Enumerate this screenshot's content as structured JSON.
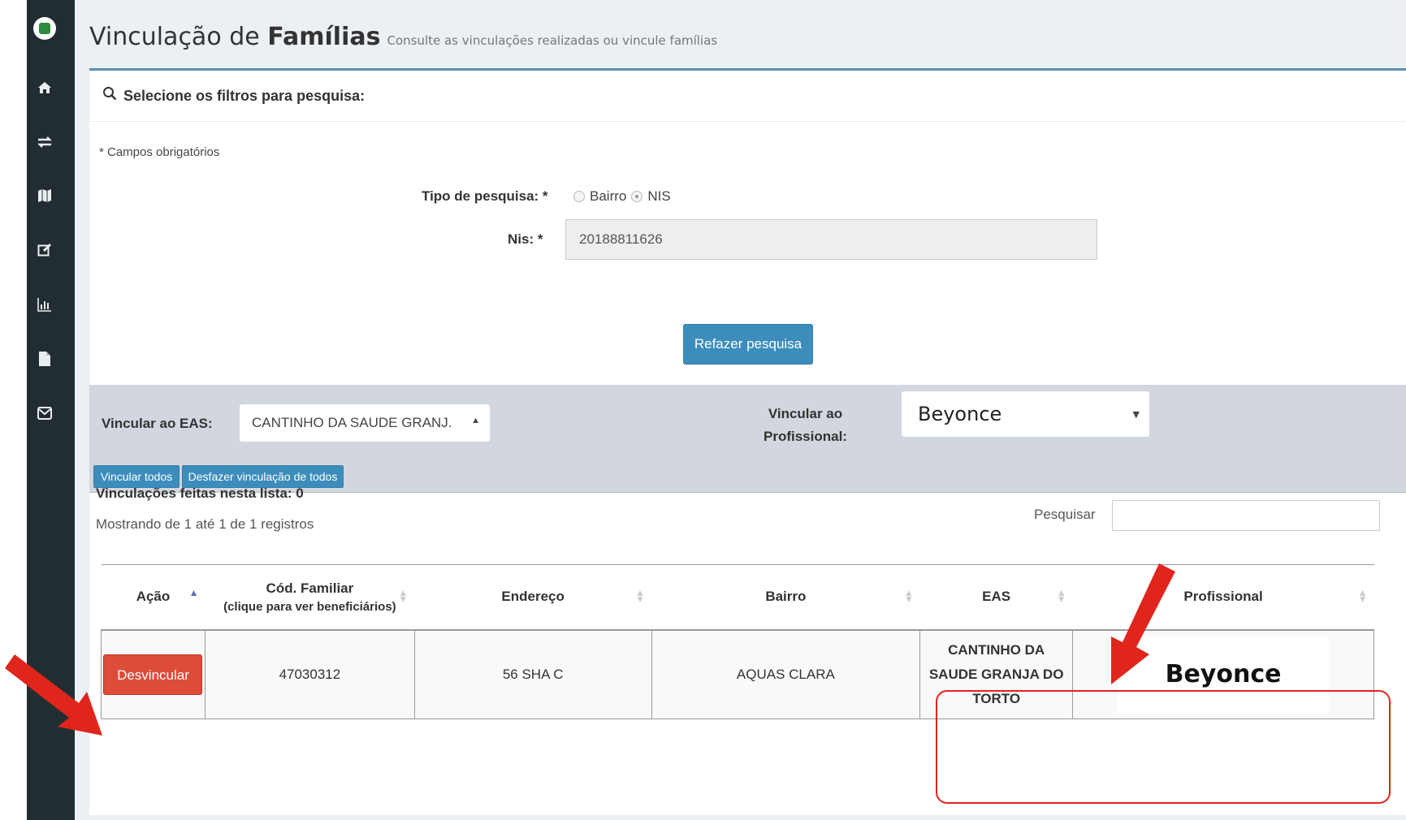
{
  "sidebar": {
    "icons": [
      "logo-icon",
      "home-icon",
      "transfer-icon",
      "map-icon",
      "edit-icon",
      "bar-chart-icon",
      "file-icon",
      "mail-icon"
    ]
  },
  "header": {
    "title_prefix": "Vinculação de",
    "title_bold": "Famílias",
    "subtitle": "Consulte as vinculações realizadas ou vincule famílias"
  },
  "filters": {
    "box_title": "Selecione os filtros para pesquisa:",
    "required_note": "* Campos obrigatórios",
    "search_type_label": "Tipo de pesquisa: *",
    "option_bairro": "Bairro",
    "option_nis": "NIS",
    "selected_option": "NIS",
    "nis_label": "Nis: *",
    "nis_value": "20188811626",
    "redo_button": "Refazer pesquisa"
  },
  "link": {
    "eas_label": "Vincular ao EAS:",
    "eas_value": "CANTINHO DA SAUDE GRANJ.",
    "prof_label_line1": "Vincular ao",
    "prof_label_line2": "Profissional:",
    "prof_value": "Beyonce",
    "link_all_button": "Vincular todos",
    "unlink_all_button": "Desfazer vinculação de todos"
  },
  "table": {
    "count_label": "Vinculações feitas nesta lista: 0",
    "showing_text": "Mostrando de 1 até 1 de 1 registros",
    "search_label": "Pesquisar",
    "columns": {
      "acao": "Ação",
      "cod": "Cód. Familiar",
      "cod_sub": "(clique para ver beneficiários)",
      "endereco": "Endereço",
      "bairro": "Bairro",
      "eas": "EAS",
      "profissional": "Profissional"
    },
    "rows": [
      {
        "action": "Desvincular",
        "cod": "47030312",
        "endereco": "56 SHA C",
        "bairro": "AQUAS CLARA",
        "eas_line1": "CANTINHO DA",
        "eas_line2": "SAUDE GRANJA DO",
        "eas_line3": "TORTO",
        "profissional": "Beyonce"
      }
    ]
  },
  "annotations": {
    "arrow_color": "#e0251c",
    "highlight_color": "#e0251c"
  }
}
